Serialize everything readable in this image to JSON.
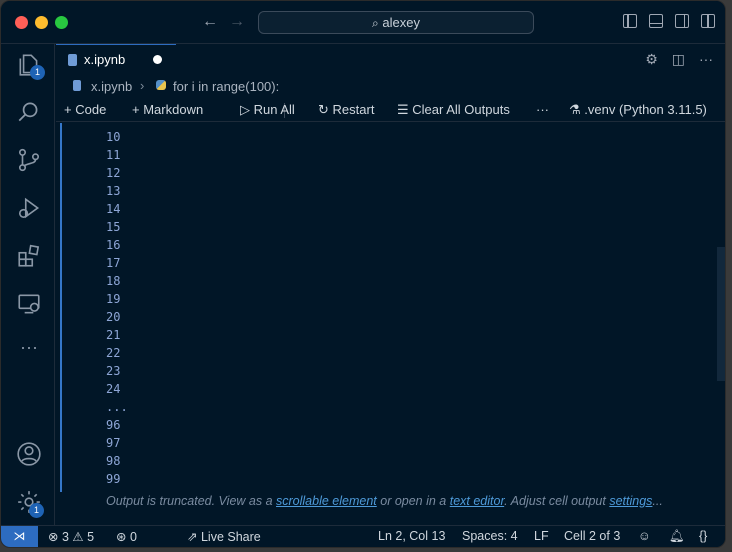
{
  "titlebar": {
    "search": "alexey"
  },
  "activity": {
    "explorer_badge": "1",
    "settings_badge": "1"
  },
  "tab": {
    "label": "x.ipynb"
  },
  "breadcrumb": {
    "file": "x.ipynb",
    "symbol": "for i in range(100):"
  },
  "toolbar": {
    "code": "Code",
    "markdown": "Markdown",
    "run_all": "Run All",
    "restart": "Restart",
    "clear_outputs": "Clear All Outputs",
    "more": "···",
    "kernel": ".venv (Python 3.11.5)"
  },
  "output": {
    "lines": [
      "10",
      "11",
      "12",
      "13",
      "14",
      "15",
      "16",
      "17",
      "18",
      "19",
      "20",
      "21",
      "22",
      "23",
      "24",
      "...",
      "96",
      "97",
      "98",
      "99"
    ],
    "trunc_prefix": "Output is truncated. View as a ",
    "trunc_link1": "scrollable element",
    "trunc_mid": " or open in a ",
    "trunc_link2": "text editor",
    "trunc_mid2": ". Adjust cell output ",
    "trunc_link3": "settings",
    "trunc_suffix": "..."
  },
  "status": {
    "errors": "3",
    "warnings": "5",
    "ports": "0",
    "live_share": "Live Share",
    "position": "Ln 2, Col 13",
    "spaces": "Spaces: 4",
    "eol": "LF",
    "cell": "Cell 2 of 3"
  }
}
